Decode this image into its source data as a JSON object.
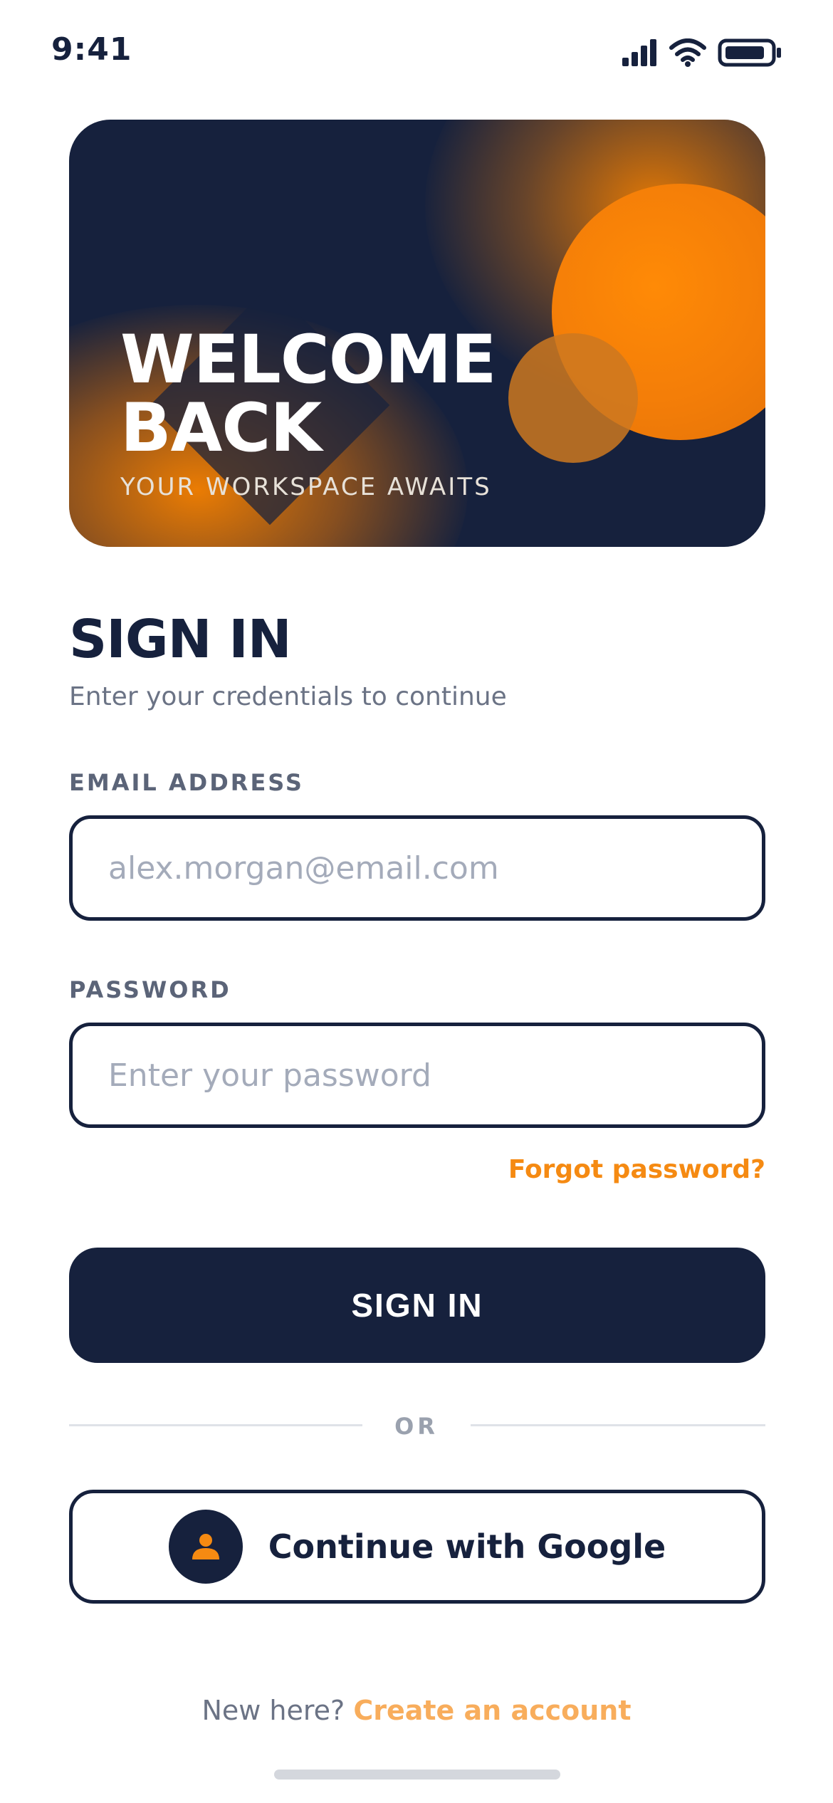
{
  "status_bar": {
    "time": "9:41"
  },
  "hero": {
    "title_line1": "WELCOME",
    "title_line2": "BACK",
    "subtitle": "YOUR WORKSPACE AWAITS"
  },
  "header": {
    "title": "SIGN IN",
    "subtitle": "Enter your credentials to continue"
  },
  "form": {
    "email_label": "EMAIL ADDRESS",
    "email_placeholder": "alex.morgan@email.com",
    "password_label": "PASSWORD",
    "password_placeholder": "Enter your password",
    "forgot_label": "Forgot password?",
    "submit_label": "SIGN IN"
  },
  "divider": {
    "label": "OR"
  },
  "google": {
    "label": "Continue with Google",
    "icon": "person-icon"
  },
  "footer": {
    "prompt": "New here?",
    "link_label": "Create an account"
  },
  "colors": {
    "navy": "#16213d",
    "accent": "#f58a12",
    "accent_light": "#f8ad5c",
    "muted": "#6b7385"
  }
}
